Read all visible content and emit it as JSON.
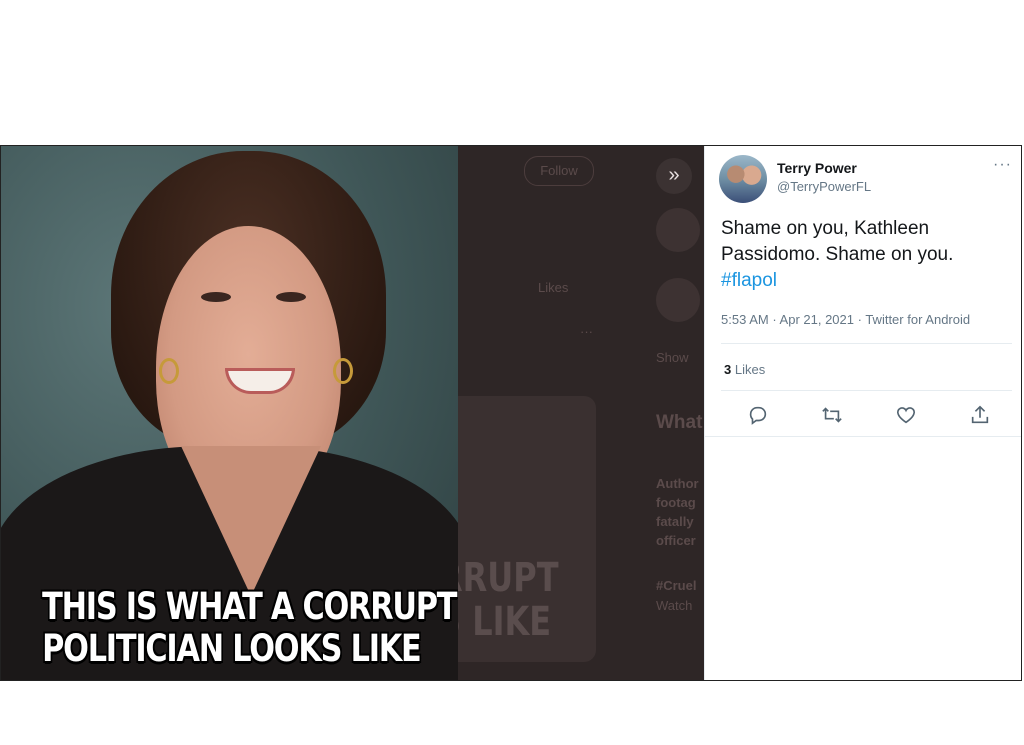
{
  "meme": {
    "caption_line1": "THIS IS WHAT A CORRUPT",
    "caption_line2": "POLITICIAN LOOKS LIKE"
  },
  "background": {
    "follow_label": "Follow",
    "likes_label": "Likes",
    "show_label": "Show",
    "what_label": "What",
    "card_text_line1": "RRUPT",
    "card_text_line2": "S LIKE",
    "trend_lines": [
      "Author",
      "footag",
      "fatally",
      "officer"
    ],
    "hashtag_fragment": "#Cruel",
    "watch_fragment": "Watch"
  },
  "tweet": {
    "display_name": "Terry Power",
    "handle": "@TerryPowerFL",
    "text": "Shame on you, Kathleen Passidomo. Shame on you.",
    "hashtag": "#flapol",
    "time": "5:53 AM",
    "date": "Apr 21, 2021",
    "source": "Twitter for Android",
    "meta_separator": " · ",
    "likes_count": "3",
    "likes_label": "Likes",
    "more_label": "···"
  },
  "icons": {
    "collapse": "double-chevron-right-icon",
    "reply": "reply-icon",
    "retweet": "retweet-icon",
    "like": "heart-icon",
    "share": "share-icon"
  },
  "colors": {
    "link": "#1b95e0",
    "overlay": "#2e2626",
    "secondary_text": "#657786"
  }
}
